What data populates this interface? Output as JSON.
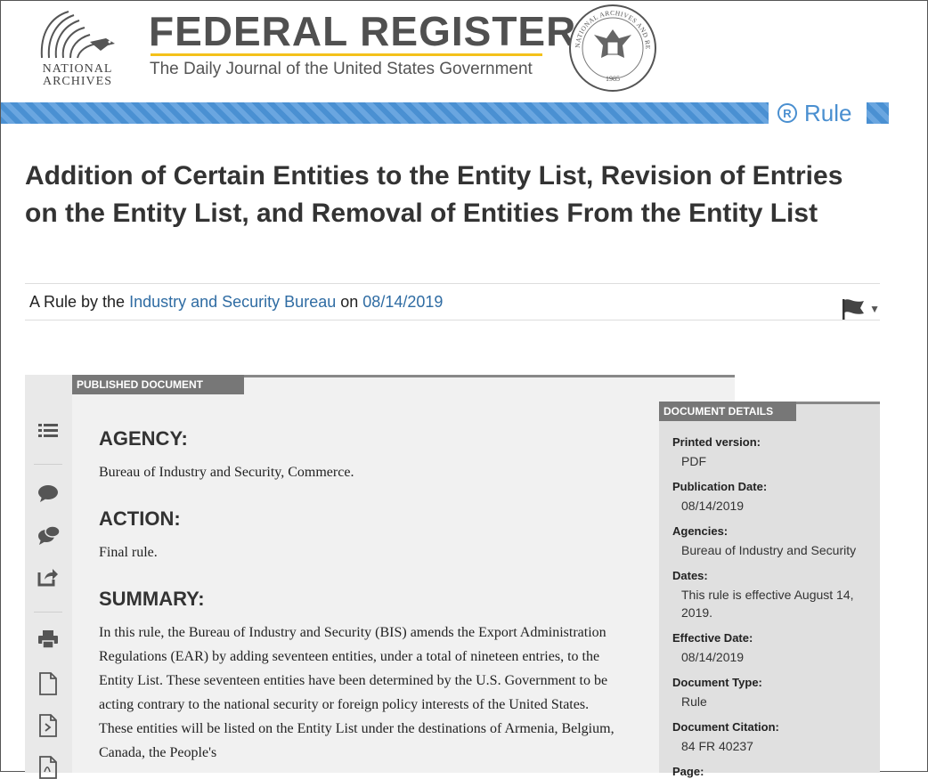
{
  "header": {
    "nara_line1": "NATIONAL",
    "nara_line2": "ARCHIVES",
    "title": "FEDERAL REGISTER",
    "subtitle": "The Daily Journal of the United States Government",
    "seal_top": "NATIONAL ARCHIVES AND RECORDS ADMINISTRATION",
    "seal_year": "1985"
  },
  "badge": {
    "letter": "R",
    "label": "Rule"
  },
  "document": {
    "title": "Addition of Certain Entities to the Entity List, Revision of Entries on the Entity List, and Removal of Entities From the Entity List",
    "byline_prefix": "A Rule by the",
    "agency_link": "Industry and Security Bureau",
    "byline_on": "on",
    "date_link": "08/14/2019"
  },
  "content": {
    "tab": "PUBLISHED DOCUMENT",
    "agency_head": "AGENCY:",
    "agency_text": "Bureau of Industry and Security, Commerce.",
    "action_head": "ACTION:",
    "action_text": "Final rule.",
    "summary_head": "SUMMARY:",
    "summary_text": "In this rule, the Bureau of Industry and Security (BIS) amends the Export Administration Regulations (EAR) by adding seventeen entities, under a total of nineteen entries, to the Entity List. These seventeen entities have been determined by the U.S. Government to be acting contrary to the national security or foreign policy interests of the United States. These entities will be listed on the Entity List under the destinations of Armenia, Belgium, Canada, the People's"
  },
  "details": {
    "tab": "DOCUMENT DETAILS",
    "printed_label": "Printed version:",
    "printed_value": "PDF",
    "pubdate_label": "Publication Date:",
    "pubdate_value": "08/14/2019",
    "agencies_label": "Agencies:",
    "agencies_value": "Bureau of Industry and Security",
    "dates_label": "Dates:",
    "dates_value": "This rule is effective August 14, 2019.",
    "effective_label": "Effective Date:",
    "effective_value": "08/14/2019",
    "doctype_label": "Document Type:",
    "doctype_value": "Rule",
    "citation_label": "Document Citation:",
    "citation_value": "84 FR 40237",
    "page_label": "Page:"
  },
  "tools": [
    "list-icon",
    "comment-icon",
    "comments-icon",
    "share-icon",
    "print-icon",
    "document-icon",
    "document-code-icon",
    "document-pdf-icon"
  ]
}
